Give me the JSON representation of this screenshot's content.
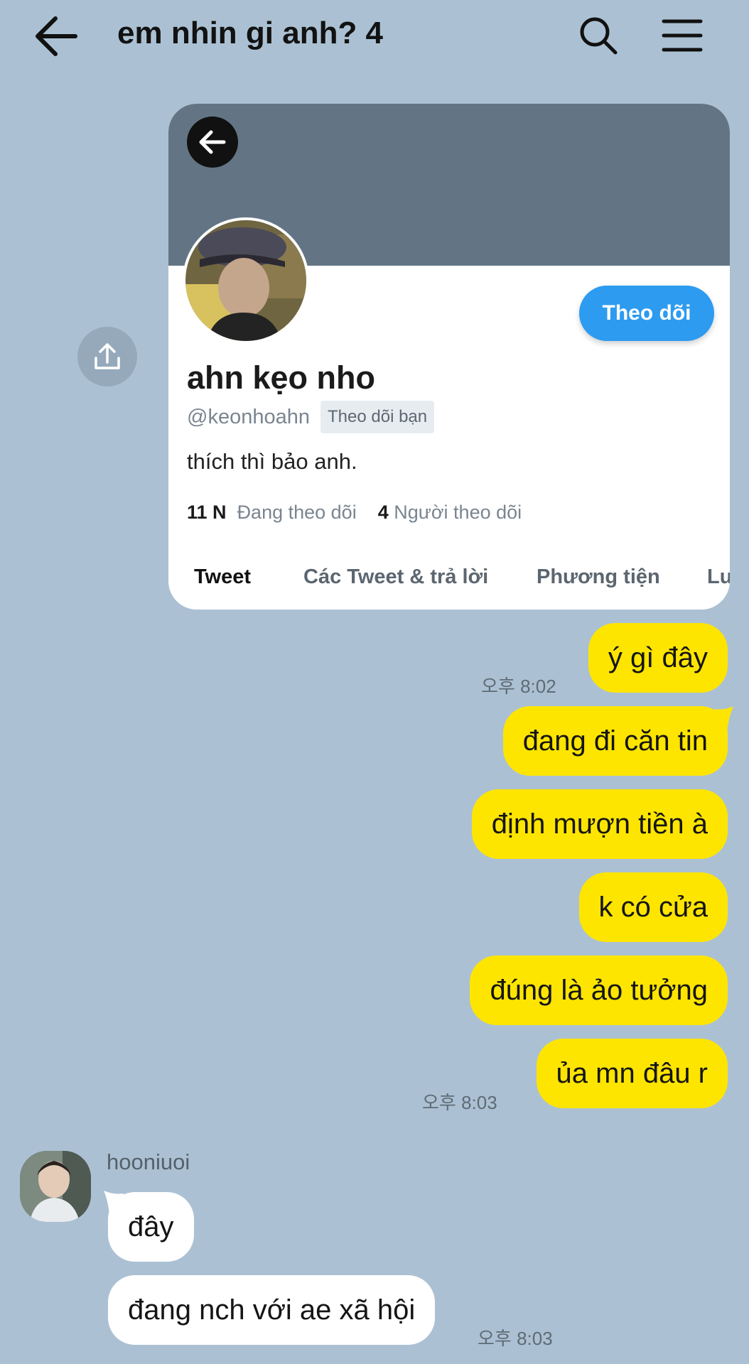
{
  "header": {
    "title": "em nhin gi anh? 4",
    "back_icon": "arrow-left-icon",
    "search_icon": "search-icon",
    "menu_icon": "hamburger-menu-icon"
  },
  "shared_profile": {
    "display_name": "ahn kẹo nho",
    "handle": "@keonhoahn",
    "follows_you_badge": "Theo dõi bạn",
    "bio": "thích thì bảo anh.",
    "follow_button": "Theo dõi",
    "following_count": "11 N",
    "following_label": "Đang theo dõi",
    "followers_count": "4",
    "followers_label": "Người theo dõi",
    "tabs": [
      "Tweet",
      "Các Tweet & trả lời",
      "Phương tiện",
      "Lu"
    ],
    "active_tab": "Tweet",
    "banner_color": "#637584",
    "follow_color": "#2d9bf0"
  },
  "messages_me": [
    {
      "text": "ý gì đây",
      "time": "오후 8:02"
    },
    {
      "text": "đang đi căn tin"
    },
    {
      "text": "định mượn tiền à"
    },
    {
      "text": "k có cửa"
    },
    {
      "text": "đúng là ảo tưởng"
    },
    {
      "text": "ủa mn đâu r",
      "time": "오후 8:03"
    }
  ],
  "friend": {
    "name": "hooniuoi",
    "messages": [
      {
        "text": "đây"
      },
      {
        "text": "đang nch với ae xã hội",
        "time": "오후 8:03"
      }
    ]
  },
  "colors": {
    "background": "#abc1d3",
    "my_bubble": "#fee500",
    "friend_bubble": "#ffffff"
  }
}
